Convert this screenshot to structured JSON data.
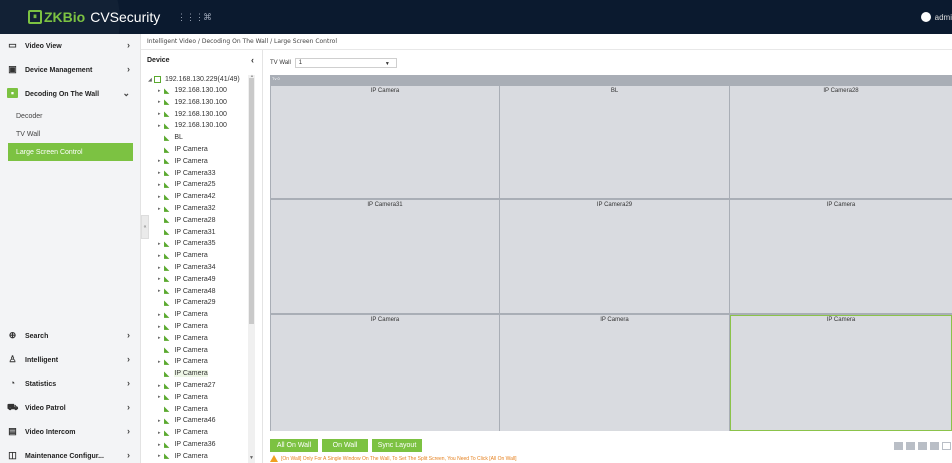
{
  "app": {
    "brand": "ZKBio",
    "product": "CVSecurity",
    "user": "admi"
  },
  "breadcrumb": "Intelligent Video / Decoding On The Wall / Large Screen Control",
  "sidebar": {
    "items": [
      {
        "label": "Video View",
        "icon": "video-view-icon"
      },
      {
        "label": "Device Management",
        "icon": "device-management-icon"
      },
      {
        "label": "Decoding On The Wall",
        "icon": "decoding-icon"
      },
      {
        "label": "Search",
        "icon": "search-icon"
      },
      {
        "label": "Intelligent",
        "icon": "intelligent-icon"
      },
      {
        "label": "Statistics",
        "icon": "statistics-icon"
      },
      {
        "label": "Video Patrol",
        "icon": "video-patrol-icon"
      },
      {
        "label": "Video Intercom",
        "icon": "video-intercom-icon"
      },
      {
        "label": "Maintenance Configur...",
        "icon": "maintenance-icon"
      }
    ],
    "subitems": [
      {
        "label": "Decoder"
      },
      {
        "label": "TV Wall"
      },
      {
        "label": "Large Screen Control",
        "active": true
      }
    ]
  },
  "tree": {
    "header": "Device",
    "root": "192.168.130.229(41/49)",
    "nodes": [
      {
        "label": "192.168.130.100",
        "expand": true
      },
      {
        "label": "192.168.130.100",
        "expand": true
      },
      {
        "label": "192.168.130.100",
        "expand": true
      },
      {
        "label": "192.168.130.100",
        "expand": true
      },
      {
        "label": "BL",
        "expand": false
      },
      {
        "label": "IP Camera",
        "expand": false
      },
      {
        "label": "IP Camera",
        "expand": true
      },
      {
        "label": "IP Camera33",
        "expand": true
      },
      {
        "label": "IP Camera25",
        "expand": true
      },
      {
        "label": "IP Camera42",
        "expand": true
      },
      {
        "label": "IP Camera32",
        "expand": true
      },
      {
        "label": "IP Camera28",
        "expand": false
      },
      {
        "label": "IP Camera31",
        "expand": false
      },
      {
        "label": "IP Camera35",
        "expand": true
      },
      {
        "label": "IP Camera",
        "expand": true
      },
      {
        "label": "IP Camera34",
        "expand": true
      },
      {
        "label": "IP Camera49",
        "expand": true
      },
      {
        "label": "IP Camera48",
        "expand": true
      },
      {
        "label": "IP Camera29",
        "expand": false
      },
      {
        "label": "IP Camera",
        "expand": true
      },
      {
        "label": "IP Camera",
        "expand": true
      },
      {
        "label": "IP Camera",
        "expand": true
      },
      {
        "label": "IP Camera",
        "expand": false
      },
      {
        "label": "IP Camera",
        "expand": true
      },
      {
        "label": "IP Camera",
        "expand": false,
        "selected": true
      },
      {
        "label": "IP Camera27",
        "expand": true
      },
      {
        "label": "IP Camera",
        "expand": true
      },
      {
        "label": "IP Camera",
        "expand": false
      },
      {
        "label": "IP Camera46",
        "expand": true
      },
      {
        "label": "IP Camera",
        "expand": true
      },
      {
        "label": "IP Camera36",
        "expand": true
      },
      {
        "label": "IP Camera",
        "expand": true
      }
    ]
  },
  "tvwall": {
    "label": "TV Wall",
    "selected": "1",
    "screen_label": "Tv 0",
    "screens": [
      "IP Camera",
      "BL",
      "IP Camera28",
      "IP Camera31",
      "IP Camera29",
      "IP Camera",
      "IP Camera",
      "IP Camera",
      "IP Camera"
    ]
  },
  "buttons": {
    "all_on_wall": "All On Wall",
    "on_wall": "On Wall",
    "sync_layout": "Sync Layout"
  },
  "notice": "[On Wall] Only For A Single Window On The Wall, To Set The Split Screen, You Need To Click [All On Wall]",
  "colors": {
    "accent": "#7cc242",
    "topbar": "#0b1a2f",
    "warning": "#e5801e"
  }
}
